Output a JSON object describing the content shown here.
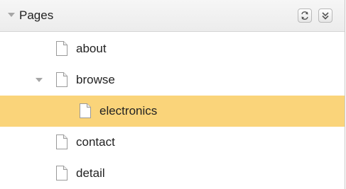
{
  "panel": {
    "title": "Pages",
    "refresh_icon": "refresh-icon",
    "collapse_icon": "collapse-all-icon"
  },
  "tree": [
    {
      "label": "about",
      "icon": "page-icon",
      "level": 1,
      "selected": false
    },
    {
      "label": "browse",
      "icon": "page-icon",
      "level": 1,
      "expanded": true,
      "selected": false
    },
    {
      "label": "electronics",
      "icon": "page-icon",
      "level": 2,
      "selected": true
    },
    {
      "label": "contact",
      "icon": "page-icon",
      "level": 1,
      "selected": false
    },
    {
      "label": "detail",
      "icon": "page-icon",
      "level": 1,
      "selected": false
    }
  ],
  "colors": {
    "selected_row": "#fad47a",
    "header_bg": "#ececec",
    "toggle": "#a6a6a6"
  }
}
